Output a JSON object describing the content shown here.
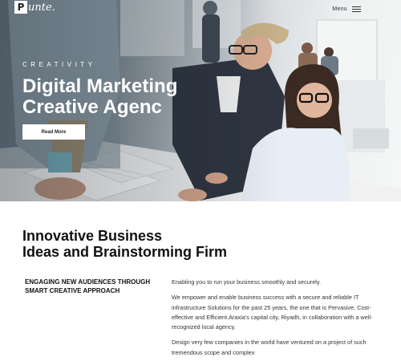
{
  "brand": {
    "logo_letter": "P",
    "logo_text": "unte."
  },
  "nav": {
    "menu_label": "Menu"
  },
  "hero": {
    "eyebrow": "CREATIVITY",
    "title_line1": "Digital Marketing",
    "title_line2": "Creative Agenc",
    "cta_label": "Read More"
  },
  "content": {
    "title_line1": "Innovative Business",
    "title_line2": "Ideas and Brainstorming Firm",
    "tagline": "ENGAGING NEW AUDIENCES THROUGH SMART CREATIVE APPROACH",
    "paragraphs": [
      "Enabling you to run your business smoothly and securely.",
      "We empower and enable business success with a secure and reliable IT infrastructure Solutions for the past 25 years, the one that is Pervasive, Cost-effective and Efficient.Araxia's capital city, Riyadh, in collaboration with a well-recognized local agency.",
      "Design very few companies in the world have ventured on a project of such tremendous scope and complex"
    ]
  }
}
